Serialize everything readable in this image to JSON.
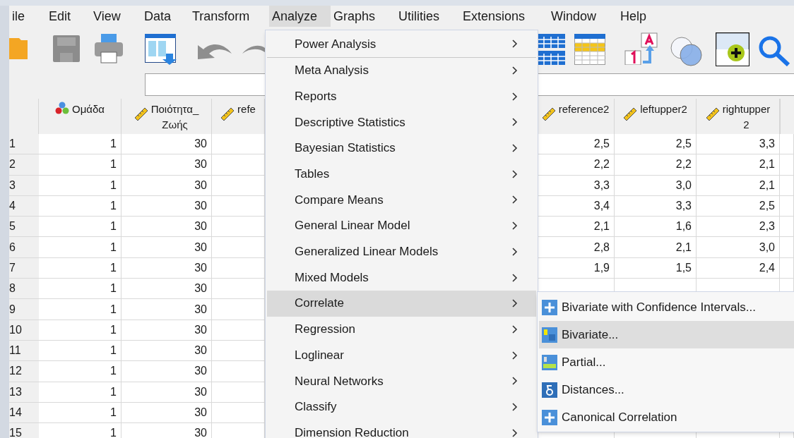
{
  "menu_bar": [
    {
      "label": "ile",
      "selected": false
    },
    {
      "label": "Edit",
      "selected": false
    },
    {
      "label": "View",
      "selected": false
    },
    {
      "label": "Data",
      "selected": false
    },
    {
      "label": "Transform",
      "selected": false
    },
    {
      "label": "Analyze",
      "selected": true
    },
    {
      "label": "Graphs",
      "selected": false
    },
    {
      "label": "Utilities",
      "selected": false
    },
    {
      "label": "Extensions",
      "selected": false
    },
    {
      "label": "Window",
      "selected": false
    },
    {
      "label": "Help",
      "selected": false
    }
  ],
  "table": {
    "row_numbers": [
      "1",
      "2",
      "3",
      "4",
      "5",
      "6",
      "7",
      "8",
      "9",
      "10",
      "11",
      "12",
      "13",
      "14",
      "15"
    ],
    "left_columns": [
      {
        "name": "Ομάδα",
        "kind": "nominal",
        "values": [
          "1",
          "1",
          "1",
          "1",
          "1",
          "1",
          "1",
          "1",
          "1",
          "1",
          "1",
          "1",
          "1",
          "1",
          "1"
        ]
      },
      {
        "name": "Ποιότητα_\nΖωής",
        "kind": "scale",
        "values": [
          "30",
          "30",
          "30",
          "30",
          "30",
          "30",
          "30",
          "30",
          "30",
          "30",
          "30",
          "30",
          "30",
          "30",
          "30"
        ]
      },
      {
        "name": "refe",
        "kind": "scale"
      }
    ],
    "right_columns": [
      {
        "name": "reference2",
        "kind": "scale",
        "values": [
          "2,5",
          "2,2",
          "3,3",
          "3,4",
          "2,1",
          "2,8",
          "1,9"
        ]
      },
      {
        "name": "leftupper2",
        "kind": "scale",
        "values": [
          "2,5",
          "2,2",
          "3,0",
          "3,3",
          "1,6",
          "2,1",
          "1,5"
        ]
      },
      {
        "name": "rightupper\n2",
        "kind": "scale",
        "values": [
          "3,3",
          "2,1",
          "2,1",
          "2,5",
          "2,3",
          "3,0",
          "2,4"
        ]
      }
    ]
  },
  "analyze_menu": [
    {
      "label": "Power Analysis",
      "selected": false,
      "separator_after": true
    },
    {
      "label": "Meta Analysis",
      "selected": false,
      "separator_after": false
    },
    {
      "label": "Reports",
      "selected": false,
      "separator_after": false
    },
    {
      "label": "Descriptive Statistics",
      "selected": false,
      "separator_after": false
    },
    {
      "label": "Bayesian Statistics",
      "selected": false,
      "separator_after": false
    },
    {
      "label": "Tables",
      "selected": false,
      "separator_after": false
    },
    {
      "label": "Compare Means",
      "selected": false,
      "separator_after": false
    },
    {
      "label": "General Linear Model",
      "selected": false,
      "separator_after": false
    },
    {
      "label": "Generalized Linear Models",
      "selected": false,
      "separator_after": false
    },
    {
      "label": "Mixed Models",
      "selected": false,
      "separator_after": false
    },
    {
      "label": "Correlate",
      "selected": true,
      "separator_after": false
    },
    {
      "label": "Regression",
      "selected": false,
      "separator_after": false
    },
    {
      "label": "Loglinear",
      "selected": false,
      "separator_after": false
    },
    {
      "label": "Neural Networks",
      "selected": false,
      "separator_after": false
    },
    {
      "label": "Classify",
      "selected": false,
      "separator_after": false
    },
    {
      "label": "Dimension Reduction",
      "selected": false,
      "separator_after": false
    }
  ],
  "correlate_submenu": [
    {
      "label": "Bivariate with Confidence Intervals...",
      "kind": "plus",
      "selected": false
    },
    {
      "label": "Bivariate...",
      "kind": "bivariate",
      "selected": true
    },
    {
      "label": "Partial...",
      "kind": "partial",
      "selected": false
    },
    {
      "label": "Distances...",
      "kind": "distance",
      "selected": false
    },
    {
      "label": "Canonical Correlation",
      "kind": "plus",
      "selected": false
    }
  ]
}
